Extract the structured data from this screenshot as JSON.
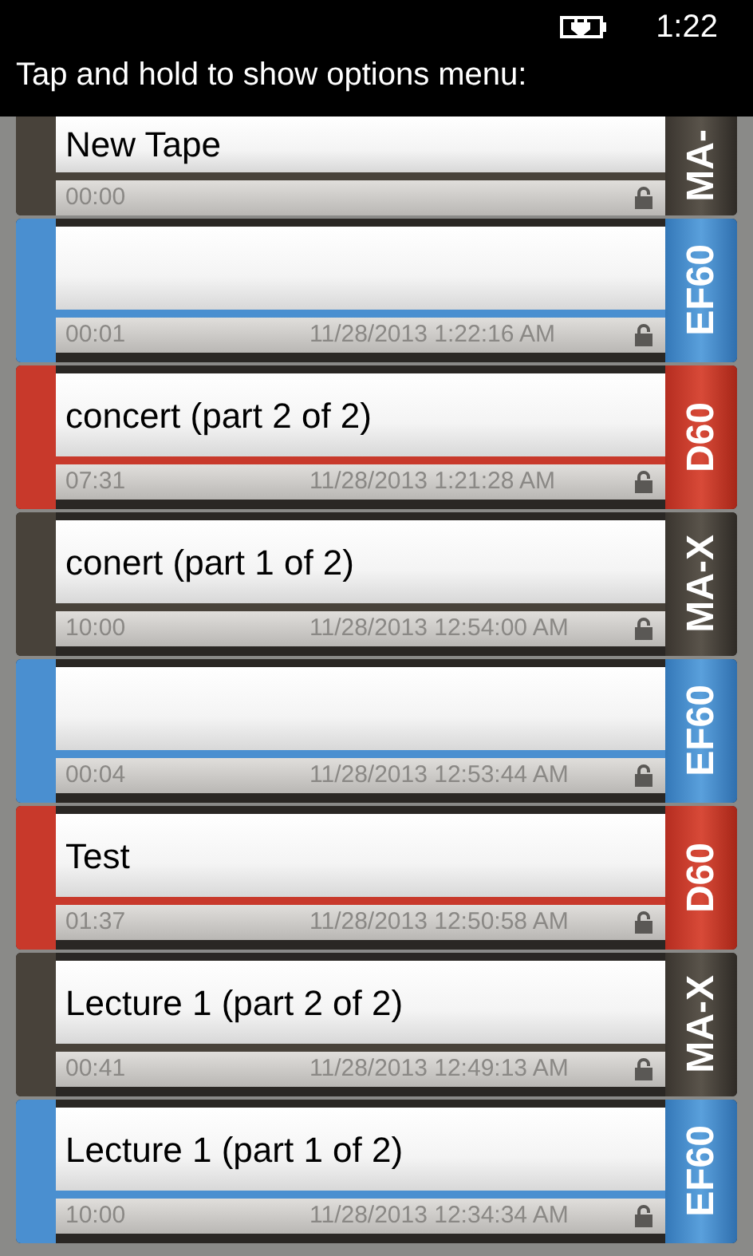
{
  "status_bar": {
    "time": "1:22"
  },
  "header": {
    "title": "Tap and hold to show options menu:"
  },
  "tapes": [
    {
      "title": "New Tape",
      "duration": "00:00",
      "type": "MA-",
      "color": "#48423a"
    },
    {
      "duration": "00:01",
      "date": "11/28/2013 1:22:16 AM",
      "type": "EF60",
      "color": "#4a8fd0"
    },
    {
      "title": "concert (part 2 of 2)",
      "duration": "07:31",
      "date": "11/28/2013 1:21:28 AM",
      "type": "D60",
      "color": "#c8392b"
    },
    {
      "title": "conert (part 1 of 2)",
      "duration": "10:00",
      "date": "11/28/2013 12:54:00 AM",
      "type": "MA-X",
      "color": "#48423a"
    },
    {
      "duration": "00:04",
      "date": "11/28/2013 12:53:44 AM",
      "type": "EF60",
      "color": "#4a8fd0"
    },
    {
      "title": "Test",
      "duration": "01:37",
      "date": "11/28/2013 12:50:58 AM",
      "type": "D60",
      "color": "#c8392b"
    },
    {
      "title": "Lecture 1 (part 2 of 2)",
      "duration": "00:41",
      "date": "11/28/2013 12:49:13 AM",
      "type": "MA-X",
      "color": "#48423a"
    },
    {
      "title": "Lecture 1 (part 1 of 2)",
      "duration": "10:00",
      "date": "11/28/2013 12:34:34 AM",
      "type": "EF60",
      "color": "#4a8fd0"
    }
  ]
}
